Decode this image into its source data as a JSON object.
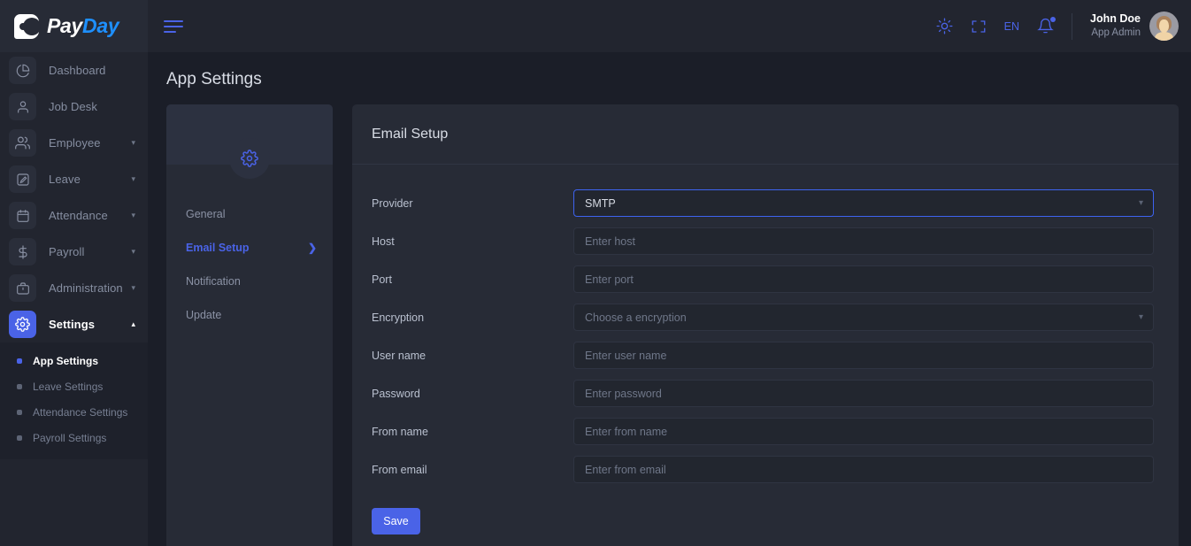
{
  "brand": {
    "logo_pay": "Pay",
    "logo_day": "Day"
  },
  "topbar": {
    "menu_icon": "hamburger-icon",
    "theme_icon": "sun-icon",
    "fullscreen_icon": "fullscreen-icon",
    "language": "EN",
    "notifications_icon": "bell-icon",
    "user_name": "John Doe",
    "user_role": "App Admin",
    "avatar": "user-avatar"
  },
  "sidebar": {
    "items": [
      {
        "label": "Dashboard",
        "icon": "pie-chart-icon",
        "expandable": false,
        "active": false
      },
      {
        "label": "Job Desk",
        "icon": "user-icon",
        "expandable": false,
        "active": false
      },
      {
        "label": "Employee",
        "icon": "users-icon",
        "expandable": true,
        "active": false
      },
      {
        "label": "Leave",
        "icon": "edit-square-icon",
        "expandable": true,
        "active": false
      },
      {
        "label": "Attendance",
        "icon": "calendar-icon",
        "expandable": true,
        "active": false
      },
      {
        "label": "Payroll",
        "icon": "dollar-icon",
        "expandable": true,
        "active": false
      },
      {
        "label": "Administration",
        "icon": "briefcase-icon",
        "expandable": true,
        "active": false
      },
      {
        "label": "Settings",
        "icon": "gear-icon",
        "expandable": true,
        "active": true
      }
    ],
    "submenu": [
      {
        "label": "App Settings",
        "active": true
      },
      {
        "label": "Leave Settings",
        "active": false
      },
      {
        "label": "Attendance Settings",
        "active": false
      },
      {
        "label": "Payroll Settings",
        "active": false
      }
    ]
  },
  "page": {
    "title": "App Settings"
  },
  "settings_panel": {
    "header_icon": "gear-icon",
    "items": [
      {
        "label": "General",
        "active": false,
        "chevron": false
      },
      {
        "label": "Email Setup",
        "active": true,
        "chevron": true
      },
      {
        "label": "Notification",
        "active": false,
        "chevron": false
      },
      {
        "label": "Update",
        "active": false,
        "chevron": false
      }
    ]
  },
  "email_setup": {
    "title": "Email Setup",
    "fields": [
      {
        "label": "Provider",
        "type": "select",
        "value": "SMTP",
        "placeholder": "",
        "focused": true
      },
      {
        "label": "Host",
        "type": "text",
        "value": "",
        "placeholder": "Enter host",
        "focused": false
      },
      {
        "label": "Port",
        "type": "text",
        "value": "",
        "placeholder": "Enter port",
        "focused": false
      },
      {
        "label": "Encryption",
        "type": "select",
        "value": "",
        "placeholder": "Choose a encryption",
        "focused": false
      },
      {
        "label": "User name",
        "type": "text",
        "value": "",
        "placeholder": "Enter user name",
        "focused": false
      },
      {
        "label": "Password",
        "type": "password",
        "value": "",
        "placeholder": "Enter password",
        "focused": false
      },
      {
        "label": "From name",
        "type": "text",
        "value": "",
        "placeholder": "Enter from name",
        "focused": false
      },
      {
        "label": "From email",
        "type": "text",
        "value": "",
        "placeholder": "Enter from email",
        "focused": false
      }
    ],
    "save_label": "Save"
  },
  "colors": {
    "accent": "#4a63e7",
    "brand_blue": "#1e90ff",
    "page_bg": "#1b1e28",
    "panel_bg": "#272b36",
    "sidebar_bg": "#22252f",
    "submenu_bg": "#1e212b",
    "input_bg": "#22262f",
    "focus_border": "#3d63f0"
  }
}
